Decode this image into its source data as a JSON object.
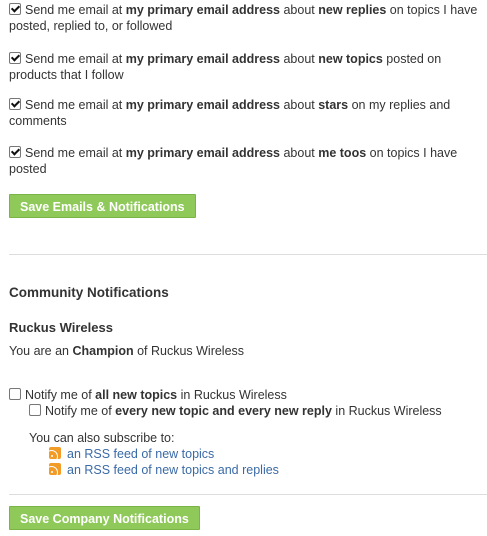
{
  "email_prefs": [
    {
      "checked": true,
      "pre": "Send me email at ",
      "b1": "my primary email address",
      "mid": " about ",
      "b2": "new replies",
      "post": " on topics I have posted, replied to, or followed"
    },
    {
      "checked": true,
      "pre": "Send me email at ",
      "b1": "my primary email address",
      "mid": " about ",
      "b2": "new topics",
      "post": " posted on products that I follow"
    },
    {
      "checked": true,
      "pre": "Send me email at ",
      "b1": "my primary email address",
      "mid": " about ",
      "b2": "stars",
      "post": " on my replies and comments"
    },
    {
      "checked": true,
      "pre": "Send me email at ",
      "b1": "my primary email address",
      "mid": " about ",
      "b2": "me toos",
      "post": " on topics I have posted"
    }
  ],
  "save_emails_button": "Save Emails & Notifications",
  "community": {
    "heading": "Community Notifications",
    "company": "Ruckus Wireless",
    "role_pre": "You are an ",
    "role": "Champion",
    "role_post": " of Ruckus Wireless",
    "notify_all": {
      "checked": false,
      "pre": "Notify me of ",
      "b": "all new topics",
      "post": " in Ruckus Wireless"
    },
    "notify_every": {
      "checked": false,
      "pre": "Notify me of ",
      "b": "every new topic and every new reply",
      "post": " in Ruckus Wireless"
    },
    "subscribe_label": "You can also subscribe to:",
    "feeds": [
      {
        "icon": "rss-feed-icon",
        "label": "an RSS feed of new topics"
      },
      {
        "icon": "rss-feed-icon",
        "label": "an RSS feed of new topics and replies"
      }
    ],
    "save_button": "Save Company Notifications"
  },
  "colors": {
    "button": "#8fc95a",
    "link": "#3a6aa6",
    "rss": "#f29c27"
  }
}
